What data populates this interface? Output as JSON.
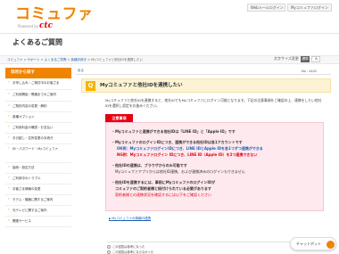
{
  "header": {
    "logo_main": "コミュファ",
    "logo_powered": "Powered by",
    "logo_brand": "ctc",
    "web_mail_button": "Webメールログイン",
    "mypage_button": "Myコミュファログイン"
  },
  "page": {
    "title": "よくあるご質問"
  },
  "breadcrumb": {
    "items": [
      "コミュファ",
      "サポート",
      "よくあるご質問",
      "各種手続き",
      "Myコミュファと他社IDを連携したい"
    ]
  },
  "font_size": {
    "label": "文字サイズ変更",
    "options": [
      "標準",
      "大"
    ],
    "selected": "標準"
  },
  "sidebar": {
    "header": "目的から探す",
    "items": [
      "お申し込み・ご検討中のお客さま",
      "ご利用開始・開通までのご案内",
      "ご契約内容の変更・解約",
      "各種オプション",
      "ご利用料金の確認・お支払い",
      "お引越し・住所変更の手続き",
      "ID・パスワード・Myコミュファ",
      "接続・設定方法",
      "ご利用中のトラブル",
      "お客さま情報の変更",
      "モデム・機器に関するご案内",
      "光テレビに関するご案内",
      "関連サービス"
    ]
  },
  "main": {
    "back_label": "戻る",
    "faq_no": "No : 4402",
    "question": "Myコミュファと他社IDを連携したい",
    "intro": "Myコミュファと他社IDを連携すると、他社IDでもMyコミュファにログイン可能となります。下記の注意事項をご確認の上、連携をしたい他社IDを選択し設定をお進みください。",
    "attention_label": "注意事項",
    "notes": [
      "・Myコミュファと連携ができる他社IDは「LINE ID」と「Apple ID」です",
      "・MyコミュファのログインIDにつき、連携ができる他社IDは各1アカウントです",
      "OK例：MyコミュファログインIDにつき、LINE IDとApple IDを各1つずつ連携ができる",
      "NG例：Myコミュファログイン IDにつき、LINE ID（Apple ID）を2つ連携できない",
      "・他社IDの連携は、ブラウザからのみ可能です",
      "Myコミュファアプリからは他社ID連携、および連携済みのログインもできません",
      "・他社IDを連携するには、事前にMyコミュファのログインIDが",
      "コミュファのご契約者様と紐付けられている必要があります",
      "契約者様との連携状況を確認するには以下をご確認ください"
    ],
    "link": "Myコミュファの情報ID連携",
    "survey": [
      "この回答は参考になった",
      "この回答は参考にならなかった"
    ]
  },
  "chatbot": {
    "label": "チャットボット"
  },
  "colors": {
    "brand_orange": "#f08300",
    "ctc_red": "#e60012",
    "question_bg": "#fdf3d4",
    "attention_bg": "#fde9ee"
  }
}
